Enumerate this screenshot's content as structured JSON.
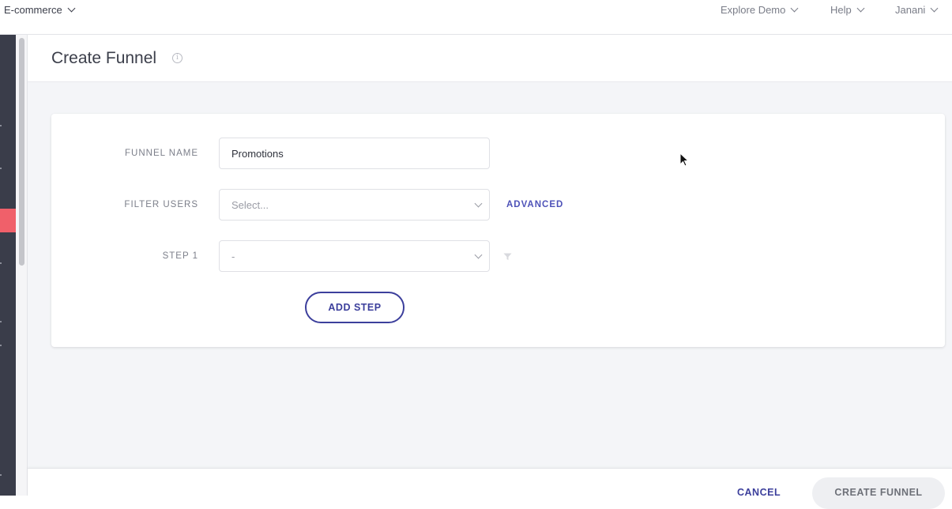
{
  "topbar": {
    "project_label": "E-commerce",
    "explore_demo": "Explore Demo",
    "help": "Help",
    "user": "Janani"
  },
  "page": {
    "title": "Create Funnel"
  },
  "form": {
    "funnel_name_label": "FUNNEL NAME",
    "funnel_name_value": "Promotions",
    "filter_users_label": "FILTER USERS",
    "filter_users_placeholder": "Select...",
    "advanced_label": "ADVANCED",
    "step1_label": "STEP 1",
    "step1_value": "-",
    "add_step_label": "ADD STEP"
  },
  "footer": {
    "cancel_label": "CANCEL",
    "create_label": "CREATE FUNNEL"
  },
  "colors": {
    "sidebar": "#3a3d4a",
    "sidebar_active": "#f0606a",
    "accent": "#3c3f9c",
    "background": "#f4f5f8"
  },
  "icons": [
    "chevron-down-icon",
    "info-icon",
    "filter-icon",
    "cursor-icon"
  ]
}
